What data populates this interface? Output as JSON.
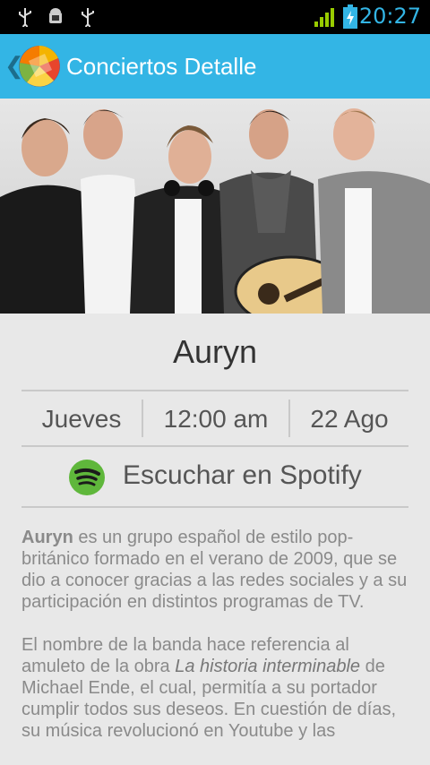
{
  "status_bar": {
    "time": "20:27",
    "left_icons": [
      "usb-icon",
      "android-debug-icon",
      "usb-icon"
    ],
    "right_icons": [
      "signal-icon",
      "battery-charging-icon"
    ],
    "accent": "#33b5e5"
  },
  "action_bar": {
    "back_glyph": "❮",
    "title": "Conciertos Detalle",
    "logo": "app-logo-icon",
    "background": "#33b5e5"
  },
  "hero": {
    "image": "band-photo"
  },
  "concert": {
    "artist": "Auryn",
    "day": "Jueves",
    "time": "12:00 am",
    "date": "22 Ago"
  },
  "spotify": {
    "label": "Escuchar en Spotify",
    "icon": "spotify-icon",
    "color": "#5fb73b"
  },
  "description": {
    "p1_lead": "Auryn",
    "p1_rest": " es un grupo español de estilo pop-británico formado en el verano de 2009, que se dio a conocer gracias a las redes sociales y a su participación en distintos programas de TV.",
    "p2_a": "El nombre de la banda hace referencia al amuleto de la obra ",
    "p2_italic": "La historia interminable",
    "p2_b": " de Michael Ende, el cual, permitía a su portador cumplir todos sus deseos. En cuestión de días, su música revolucionó en Youtube y las"
  }
}
